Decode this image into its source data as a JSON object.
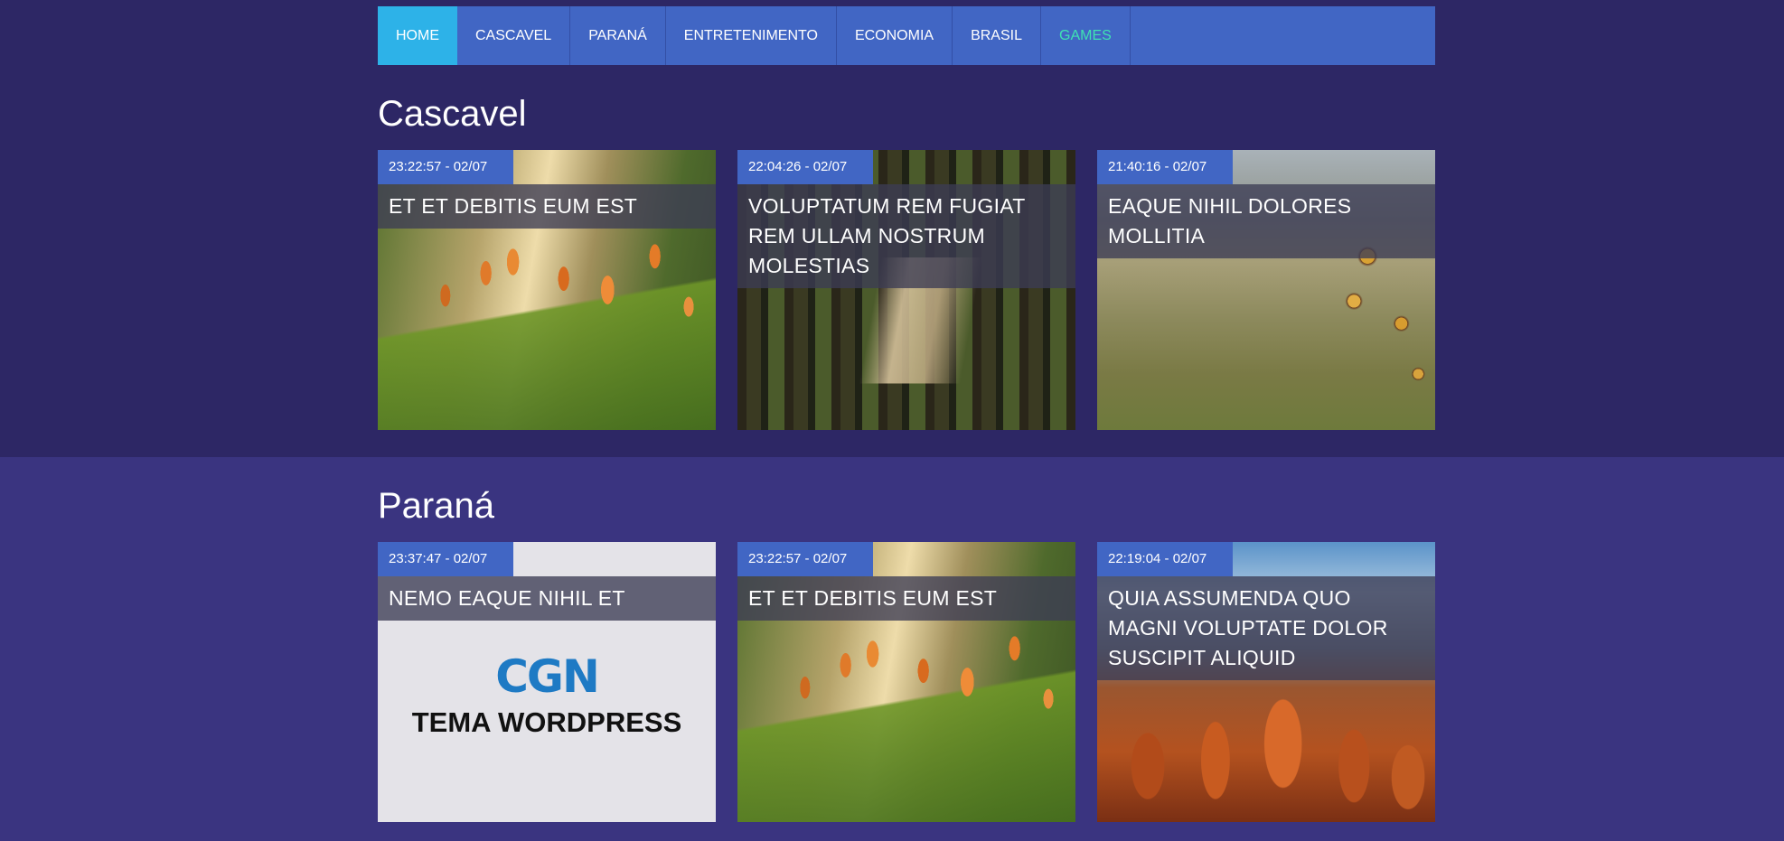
{
  "nav": {
    "items": [
      {
        "label": "Home"
      },
      {
        "label": "Cascavel"
      },
      {
        "label": "Paraná"
      },
      {
        "label": "Entretenimento"
      },
      {
        "label": "Economia"
      },
      {
        "label": "Brasil"
      },
      {
        "label": "Games"
      }
    ],
    "active_color": "#2db2e8",
    "bar_color": "#4166c4",
    "games_color": "#3fe2b3"
  },
  "sections": [
    {
      "title": "Cascavel",
      "cards": [
        {
          "time": "23:22:57 - 02/07",
          "headline": "Et et debitis eum est",
          "image": "tulips-photo"
        },
        {
          "time": "22:04:26 - 02/07",
          "headline": "Voluptatum rem fugiat rem ullam nostrum molestias",
          "image": "forest-path-photo"
        },
        {
          "time": "21:40:16 - 02/07",
          "headline": "Eaque nihil dolores mollitia",
          "image": "thistle-valley-photo"
        }
      ]
    },
    {
      "title": "Paraná",
      "cards": [
        {
          "time": "23:37:47 - 02/07",
          "headline": "Nemo eaque nihil et",
          "image": "cgn-placeholder",
          "logo_text": "CGN",
          "tagline": "TEMA WORDPRESS"
        },
        {
          "time": "23:22:57 - 02/07",
          "headline": "Et et debitis eum est",
          "image": "tulips-photo"
        },
        {
          "time": "22:19:04 - 02/07",
          "headline": "Quia assumenda quo magni voluptate dolor suscipit aliquid",
          "image": "canyon-photo"
        }
      ]
    }
  ],
  "colors": {
    "top_band": "#2d2765",
    "bottom_band": "#3a3480",
    "stamp": "#4166c4"
  }
}
